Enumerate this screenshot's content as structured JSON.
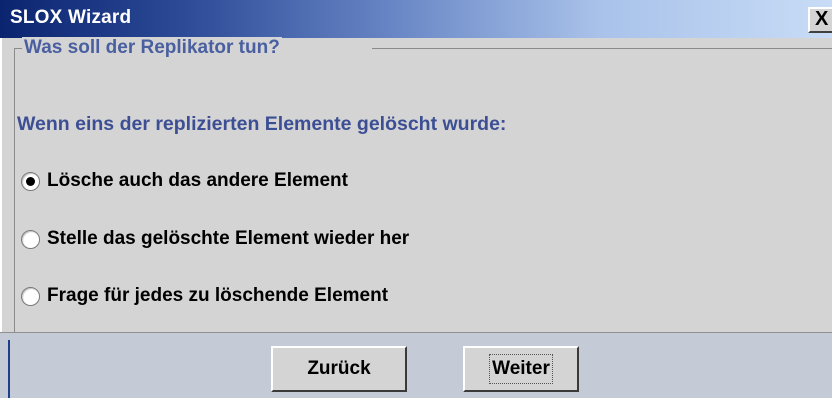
{
  "window": {
    "title": "SLOX Wizard",
    "close_label": "X"
  },
  "group": {
    "title": "Was soll der Replikator tun?"
  },
  "question": "Wenn eins der replizierten Elemente gelöscht wurde:",
  "options": [
    {
      "label": "Lösche auch das andere Element",
      "selected": true
    },
    {
      "label": "Stelle das gelöschte Element wieder her",
      "selected": false
    },
    {
      "label": "Frage für jedes zu löschende Element",
      "selected": false
    }
  ],
  "buttons": {
    "back_label": "Zurück",
    "next_label": "Weiter"
  },
  "colors": {
    "title_gradient_start": "#0b2470",
    "title_gradient_end": "#c8dcf6",
    "group_title_text": "#4a5fa0",
    "question_text": "#3d4f94",
    "panel_background": "#d4d4d4",
    "button_bar_background": "#c4cad6"
  }
}
